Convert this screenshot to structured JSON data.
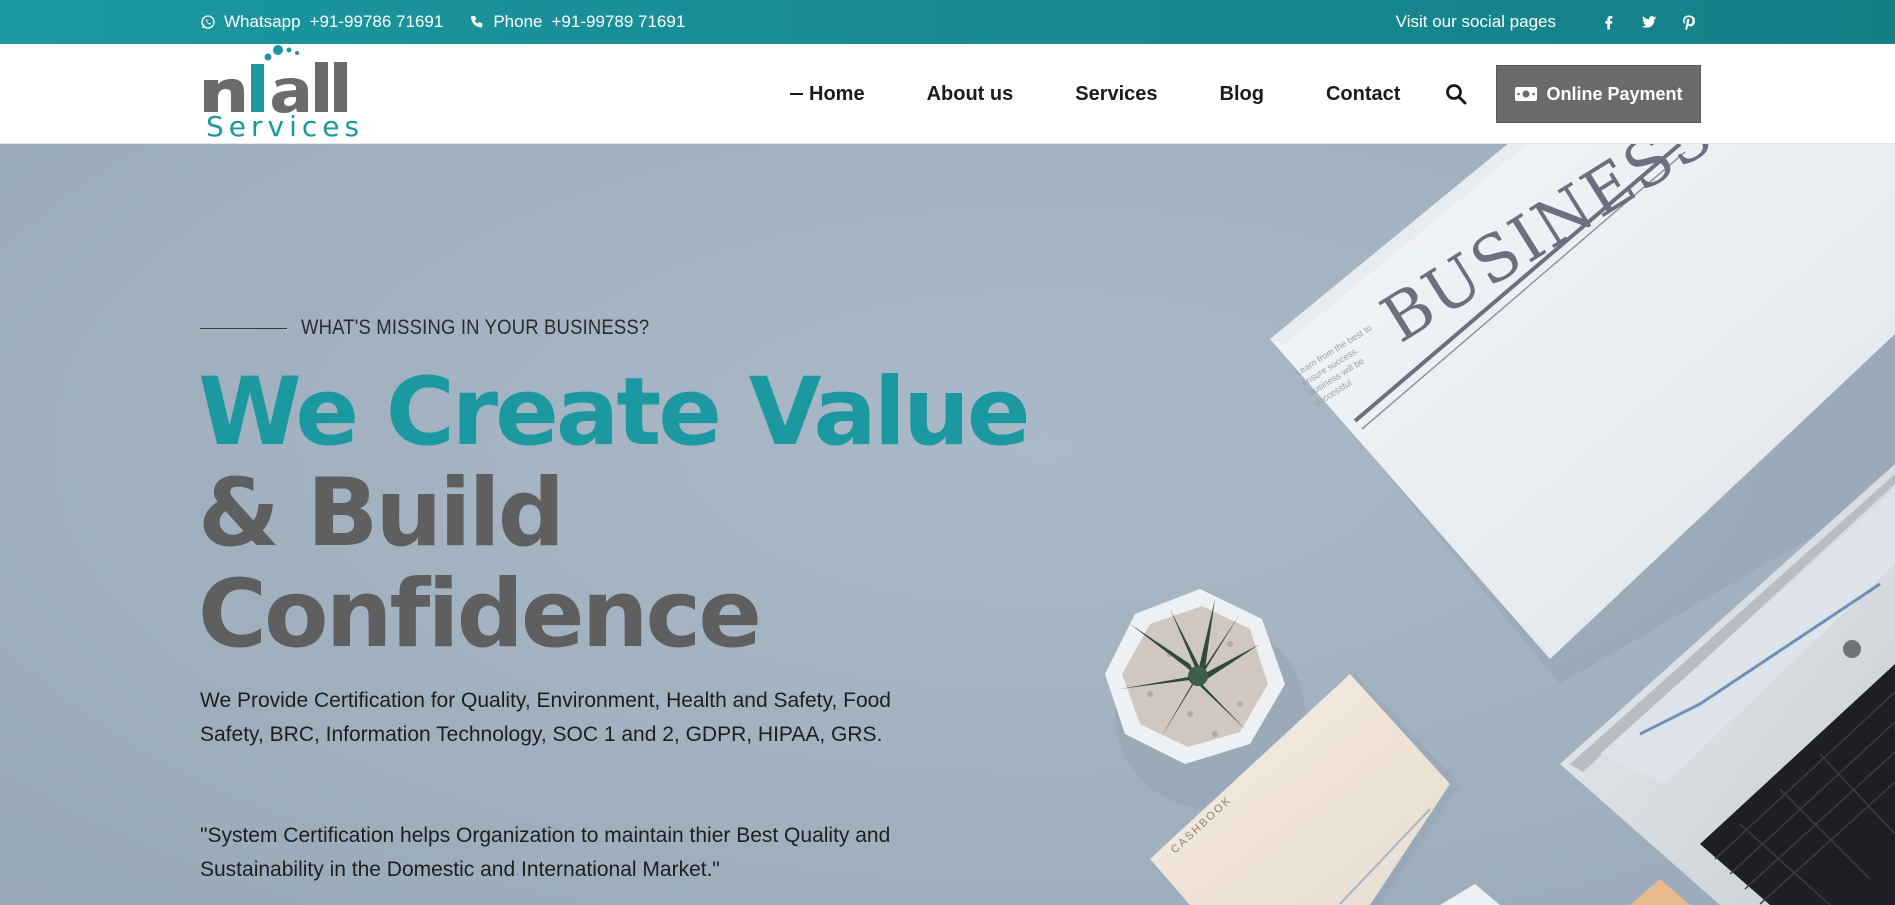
{
  "topbar": {
    "whatsapp_label": "Whatsapp",
    "whatsapp_number": "+91-99786 71691",
    "phone_label": "Phone",
    "phone_number": "+91-99789 71691",
    "social_label": "Visit our social pages",
    "social_icons": [
      "facebook-icon",
      "twitter-icon",
      "pinterest-icon"
    ]
  },
  "logo": {
    "word": "niall",
    "sub": "Services"
  },
  "nav": {
    "items": [
      {
        "label": "Home",
        "active": true
      },
      {
        "label": "About us"
      },
      {
        "label": "Services"
      },
      {
        "label": "Blog"
      },
      {
        "label": "Contact"
      }
    ],
    "search_icon": "search-icon",
    "payment_button": "Online Payment",
    "payment_icon": "money-icon"
  },
  "hero": {
    "eyebrow": "WHAT'S MISSING IN YOUR BUSINESS?",
    "headline_line1": "We Create Value",
    "headline_line2": "& Build",
    "headline_line3": "Confidence",
    "description": "We Provide Certification for Quality, Environment, Health and Safety, Food Safety, BRC, Information Technology, SOC 1 and 2, GDPR, HIPAA, GRS.",
    "quote": "\"System Certification helps Organization to maintain thier Best Quality and Sustainability in the Domestic and International Market.\"",
    "image_newspaper_text": "BUSINESS",
    "image_newspaper_small": "Learn from the best to ensure success. Business will be successful",
    "image_notebook_text": "CASHBOOK"
  },
  "colors": {
    "brand_teal": "#1b98a0",
    "headline_gray": "#5f5f5f",
    "payment_button_bg": "#6b6b6b",
    "hero_bg": "#a3b3c2"
  }
}
